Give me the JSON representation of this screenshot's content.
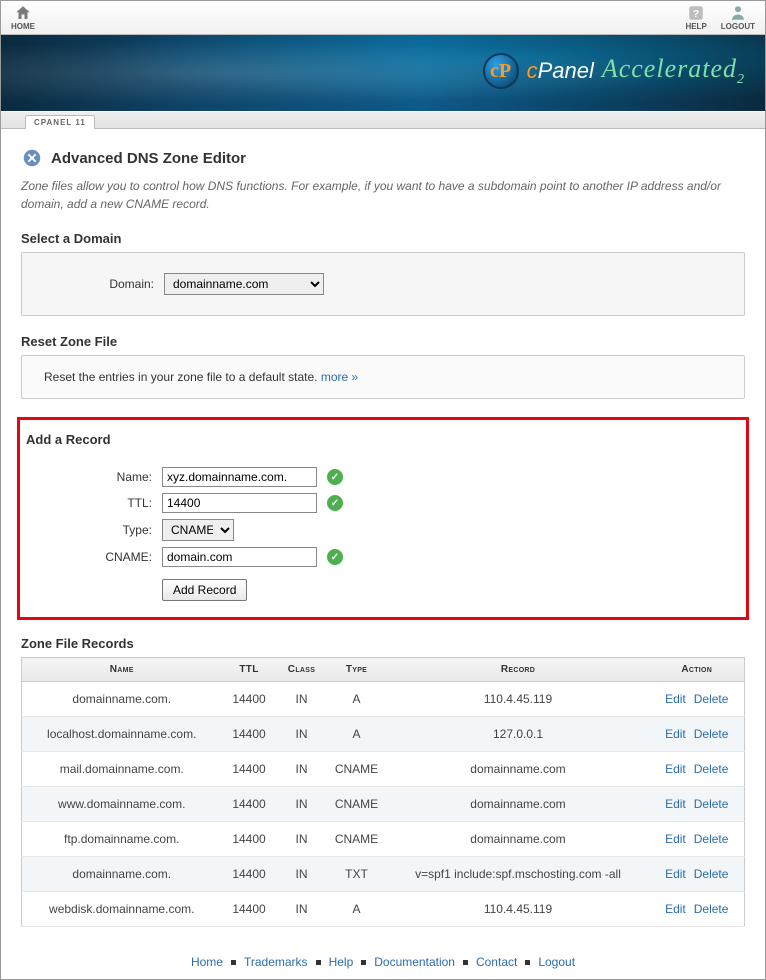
{
  "topnav": {
    "home": "HOME",
    "help": "HELP",
    "logout": "LOGOUT"
  },
  "banner": {
    "brand_c": "c",
    "brand_panel": "Panel",
    "accelerated": "Accelerated",
    "sub": "2"
  },
  "tabs": {
    "active": "CPANEL 11"
  },
  "page": {
    "title": "Advanced DNS Zone Editor",
    "desc": "Zone files allow you to control how DNS functions. For example, if you want to have a subdomain point to another IP address and/or domain, add a new CNAME record."
  },
  "select_domain": {
    "heading": "Select a Domain",
    "label": "Domain:",
    "value": "domainname.com"
  },
  "reset": {
    "heading": "Reset Zone File",
    "text": "Reset the entries in your zone file to a default state. ",
    "link": "more »"
  },
  "add_record": {
    "heading": "Add a Record",
    "name_label": "Name:",
    "name_value": "xyz.domainname.com.",
    "ttl_label": "TTL:",
    "ttl_value": "14400",
    "type_label": "Type:",
    "type_value": "CNAME",
    "cname_label": "CNAME:",
    "cname_value": "domain.com",
    "button": "Add Record"
  },
  "zone": {
    "heading": "Zone File Records",
    "cols": {
      "name": "Name",
      "ttl": "TTL",
      "class": "Class",
      "type": "Type",
      "record": "Record",
      "action": "Action"
    },
    "edit": "Edit",
    "delete": "Delete",
    "rows": [
      {
        "name": "domainname.com.",
        "ttl": "14400",
        "class": "IN",
        "type": "A",
        "record": "110.4.45.119"
      },
      {
        "name": "localhost.domainname.com.",
        "ttl": "14400",
        "class": "IN",
        "type": "A",
        "record": "127.0.0.1"
      },
      {
        "name": "mail.domainname.com.",
        "ttl": "14400",
        "class": "IN",
        "type": "CNAME",
        "record": "domainname.com"
      },
      {
        "name": "www.domainname.com.",
        "ttl": "14400",
        "class": "IN",
        "type": "CNAME",
        "record": "domainname.com"
      },
      {
        "name": "ftp.domainname.com.",
        "ttl": "14400",
        "class": "IN",
        "type": "CNAME",
        "record": "domainname.com"
      },
      {
        "name": "domainname.com.",
        "ttl": "14400",
        "class": "IN",
        "type": "TXT",
        "record": "v=spf1 include:spf.mschosting.com -all"
      },
      {
        "name": "webdisk.domainname.com.",
        "ttl": "14400",
        "class": "IN",
        "type": "A",
        "record": "110.4.45.119"
      }
    ]
  },
  "footer": {
    "links": [
      "Home",
      "Trademarks",
      "Help",
      "Documentation",
      "Contact",
      "Logout"
    ]
  }
}
